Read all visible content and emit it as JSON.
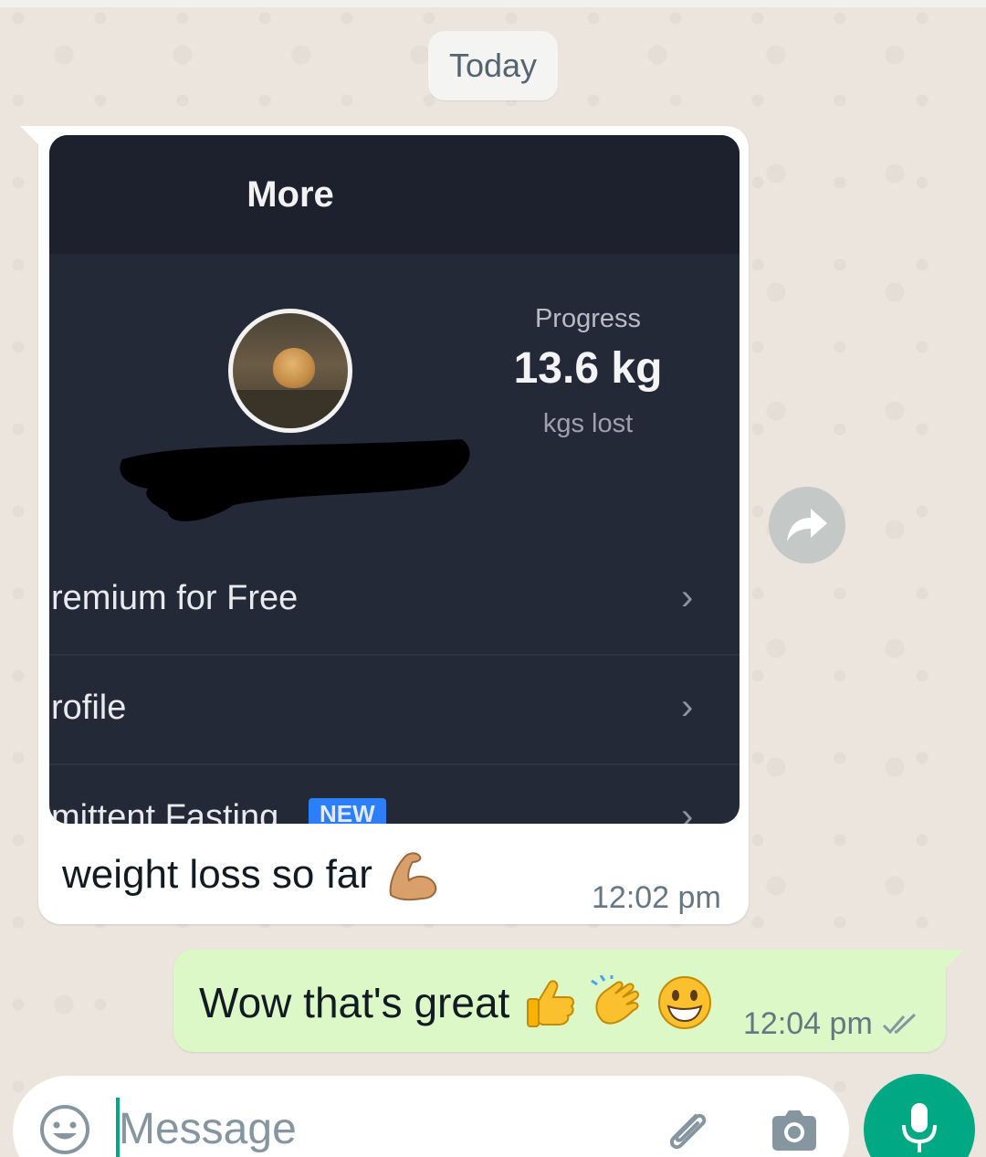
{
  "date_chip": "Today",
  "incoming": {
    "screenshot": {
      "header_title": "More",
      "progress_label": "Progress",
      "progress_value": "13.6 kg",
      "progress_unit": "kgs lost",
      "menu_items": [
        {
          "label": "remium for Free"
        },
        {
          "label": "rofile"
        },
        {
          "label": "mittent Fasting",
          "badge": "NEW"
        }
      ]
    },
    "caption": "weight loss so far",
    "caption_emoji": "flexed-biceps",
    "time": "12:02 pm"
  },
  "outgoing": {
    "text": "Wow that's great",
    "emojis": [
      "thumbs-up",
      "clapping-hands",
      "grinning-face"
    ],
    "time": "12:04 pm",
    "status": "delivered-double-tick"
  },
  "composer": {
    "placeholder": "Message"
  },
  "colors": {
    "accent": "#00a884",
    "outgoing_bubble": "#dcf8c6",
    "chat_background": "#ece5dd",
    "screenshot_bg": "#242937",
    "badge_blue": "#2d7ff9"
  }
}
